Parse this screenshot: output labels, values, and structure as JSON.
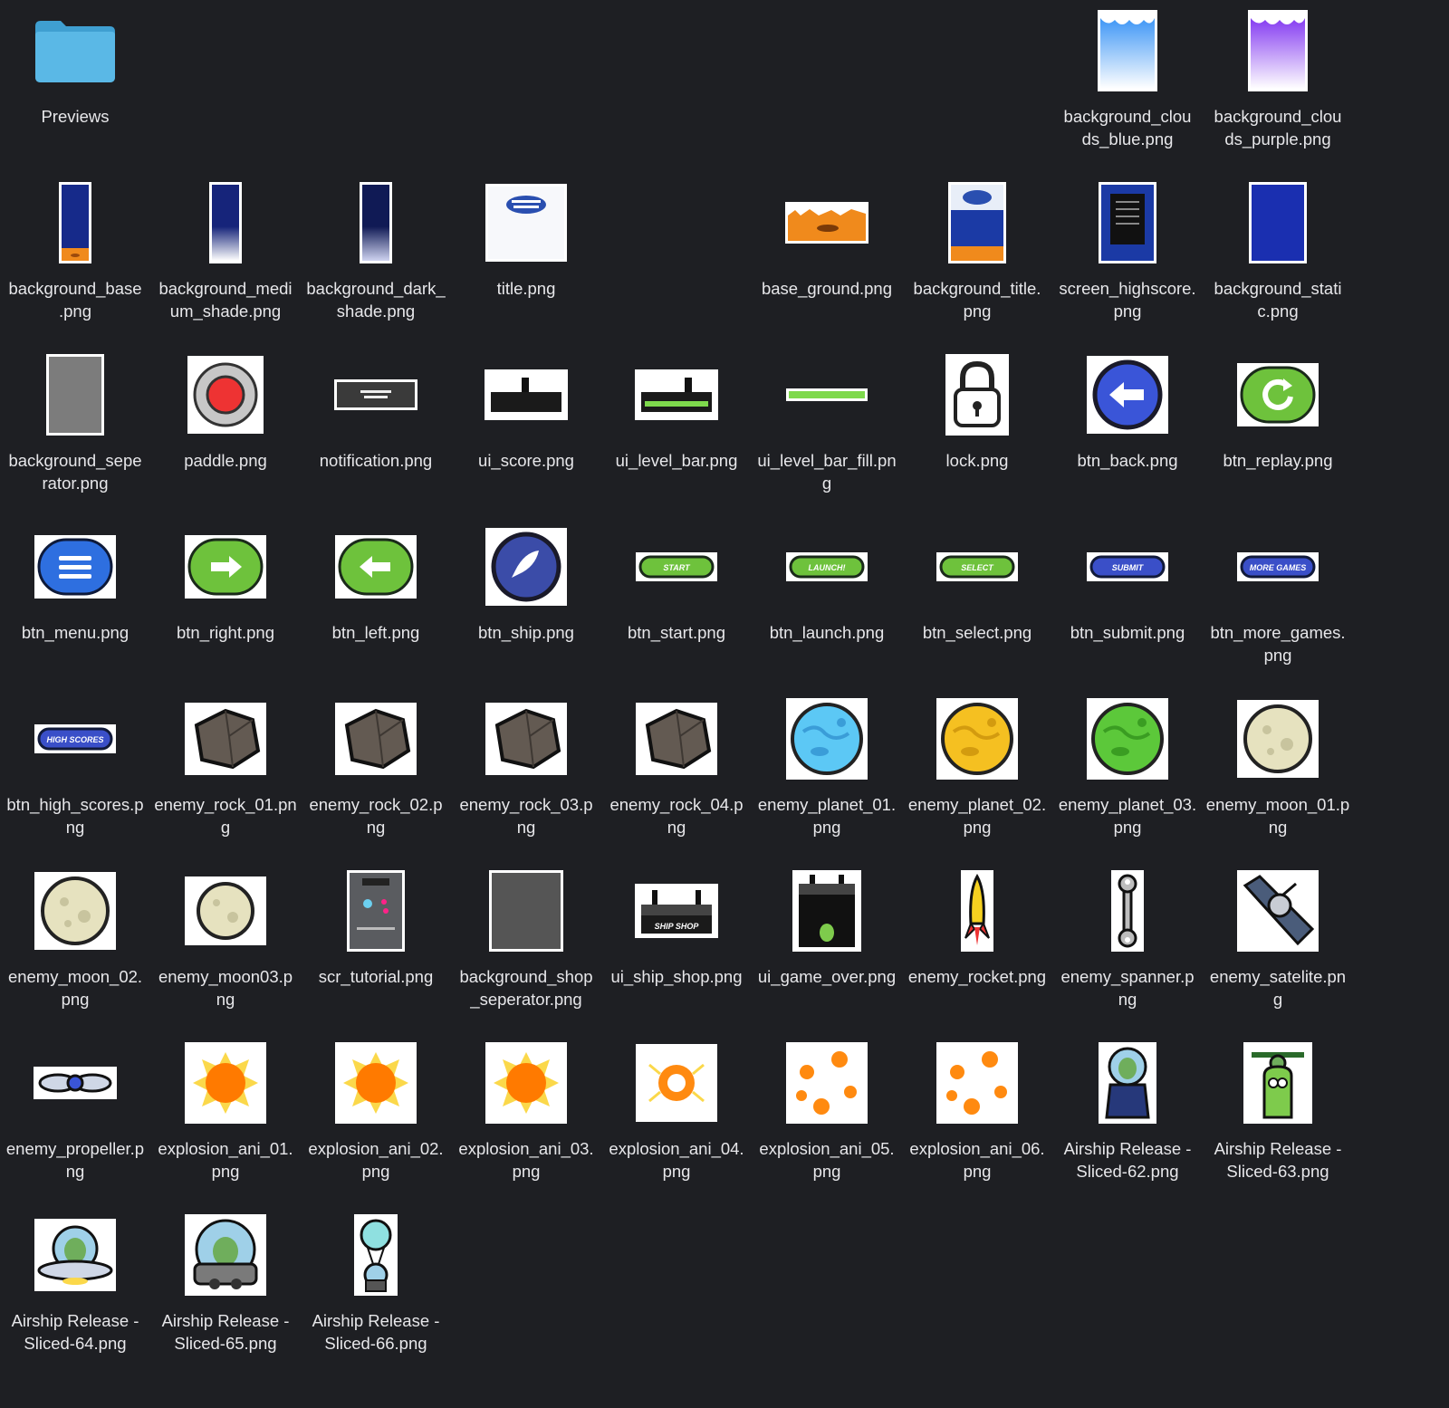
{
  "files": [
    {
      "name": "Previews",
      "icon": "folder-icon",
      "row": 0,
      "col": 0
    },
    {
      "name": "background_clou\nds_blue.png",
      "icon": "clouds-blue-image-icon",
      "row": 0,
      "col": 7
    },
    {
      "name": "background_clou\nds_purple.png",
      "icon": "clouds-purple-image-icon",
      "row": 0,
      "col": 8
    },
    {
      "name": "background_base\n.png",
      "icon": "background-base-image-icon",
      "row": 1,
      "col": 0
    },
    {
      "name": "background_medi\num_shade.png",
      "icon": "background-medium-shade-image-icon",
      "row": 1,
      "col": 1
    },
    {
      "name": "background_dark_\nshade.png",
      "icon": "background-dark-shade-image-icon",
      "row": 1,
      "col": 2
    },
    {
      "name": "title.png",
      "icon": "title-image-icon",
      "row": 1,
      "col": 3
    },
    {
      "name": "base_ground.png",
      "icon": "ground-image-icon",
      "row": 1,
      "col": 5
    },
    {
      "name": "background_title.\npng",
      "icon": "background-title-image-icon",
      "row": 1,
      "col": 6
    },
    {
      "name": "screen_highscore.\npng",
      "icon": "highscore-screen-image-icon",
      "row": 1,
      "col": 7
    },
    {
      "name": "background_stati\nc.png",
      "icon": "background-static-image-icon",
      "row": 1,
      "col": 8
    },
    {
      "name": "background_sepe\nrator.png",
      "icon": "separator-image-icon",
      "row": 2,
      "col": 0
    },
    {
      "name": "paddle.png",
      "icon": "paddle-image-icon",
      "row": 2,
      "col": 1
    },
    {
      "name": "notification.png",
      "icon": "notification-image-icon",
      "row": 2,
      "col": 2
    },
    {
      "name": "ui_score.png",
      "icon": "score-ui-image-icon",
      "row": 2,
      "col": 3
    },
    {
      "name": "ui_level_bar.png",
      "icon": "level-bar-image-icon",
      "row": 2,
      "col": 4
    },
    {
      "name": "ui_level_bar_fill.pn\ng",
      "icon": "level-bar-fill-image-icon",
      "row": 2,
      "col": 5
    },
    {
      "name": "lock.png",
      "icon": "lock-image-icon",
      "row": 2,
      "col": 6
    },
    {
      "name": "btn_back.png",
      "icon": "back-button-image-icon",
      "row": 2,
      "col": 7
    },
    {
      "name": "btn_replay.png",
      "icon": "replay-button-image-icon",
      "row": 2,
      "col": 8
    },
    {
      "name": "btn_menu.png",
      "icon": "menu-button-image-icon",
      "row": 3,
      "col": 0
    },
    {
      "name": "btn_right.png",
      "icon": "right-button-image-icon",
      "row": 3,
      "col": 1
    },
    {
      "name": "btn_left.png",
      "icon": "left-button-image-icon",
      "row": 3,
      "col": 2
    },
    {
      "name": "btn_ship.png",
      "icon": "ship-button-image-icon",
      "row": 3,
      "col": 3
    },
    {
      "name": "btn_start.png",
      "icon": "start-button-image-icon",
      "row": 3,
      "col": 4,
      "text": "START"
    },
    {
      "name": "btn_launch.png",
      "icon": "launch-button-image-icon",
      "row": 3,
      "col": 5,
      "text": "LAUNCH!"
    },
    {
      "name": "btn_select.png",
      "icon": "select-button-image-icon",
      "row": 3,
      "col": 6,
      "text": "SELECT"
    },
    {
      "name": "btn_submit.png",
      "icon": "submit-button-image-icon",
      "row": 3,
      "col": 7,
      "text": "SUBMIT"
    },
    {
      "name": "btn_more_games.\npng",
      "icon": "more-games-button-image-icon",
      "row": 3,
      "col": 8,
      "text": "MORE GAMES"
    },
    {
      "name": "btn_high_scores.p\nng",
      "icon": "high-scores-button-image-icon",
      "row": 4,
      "col": 0,
      "text": "HIGH SCORES"
    },
    {
      "name": "enemy_rock_01.pn\ng",
      "icon": "rock-image-icon",
      "row": 4,
      "col": 1
    },
    {
      "name": "enemy_rock_02.p\nng",
      "icon": "rock-image-icon",
      "row": 4,
      "col": 2
    },
    {
      "name": "enemy_rock_03.p\nng",
      "icon": "rock-image-icon",
      "row": 4,
      "col": 3
    },
    {
      "name": "enemy_rock_04.p\nng",
      "icon": "rock-image-icon",
      "row": 4,
      "col": 4
    },
    {
      "name": "enemy_planet_01.\npng",
      "icon": "planet-blue-image-icon",
      "row": 4,
      "col": 5
    },
    {
      "name": "enemy_planet_02.\npng",
      "icon": "planet-yellow-image-icon",
      "row": 4,
      "col": 6
    },
    {
      "name": "enemy_planet_03.\npng",
      "icon": "planet-green-image-icon",
      "row": 4,
      "col": 7
    },
    {
      "name": "enemy_moon_01.p\nng",
      "icon": "moon-image-icon",
      "row": 4,
      "col": 8
    },
    {
      "name": "enemy_moon_02.\npng",
      "icon": "moon-image-icon",
      "row": 5,
      "col": 0
    },
    {
      "name": "enemy_moon03.p\nng",
      "icon": "moon-small-image-icon",
      "row": 5,
      "col": 1
    },
    {
      "name": "scr_tutorial.png",
      "icon": "tutorial-screen-image-icon",
      "row": 5,
      "col": 2
    },
    {
      "name": "background_shop\n_seperator.png",
      "icon": "shop-separator-image-icon",
      "row": 5,
      "col": 3
    },
    {
      "name": "ui_ship_shop.png",
      "icon": "ship-shop-image-icon",
      "row": 5,
      "col": 4,
      "text": "SHIP SHOP"
    },
    {
      "name": "ui_game_over.png",
      "icon": "game-over-image-icon",
      "row": 5,
      "col": 5
    },
    {
      "name": "enemy_rocket.png",
      "icon": "rocket-image-icon",
      "row": 5,
      "col": 6
    },
    {
      "name": "enemy_spanner.p\nng",
      "icon": "spanner-image-icon",
      "row": 5,
      "col": 7
    },
    {
      "name": "enemy_satelite.pn\ng",
      "icon": "satellite-image-icon",
      "row": 5,
      "col": 8
    },
    {
      "name": "enemy_propeller.p\nng",
      "icon": "propeller-image-icon",
      "row": 6,
      "col": 0
    },
    {
      "name": "explosion_ani_01.\npng",
      "icon": "explosion-image-icon",
      "row": 6,
      "col": 1
    },
    {
      "name": "explosion_ani_02.\npng",
      "icon": "explosion-image-icon",
      "row": 6,
      "col": 2
    },
    {
      "name": "explosion_ani_03.\npng",
      "icon": "explosion-image-icon",
      "row": 6,
      "col": 3
    },
    {
      "name": "explosion_ani_04.\npng",
      "icon": "explosion-ring-image-icon",
      "row": 6,
      "col": 4
    },
    {
      "name": "explosion_ani_05.\npng",
      "icon": "explosion-scatter-image-icon",
      "row": 6,
      "col": 5
    },
    {
      "name": "explosion_ani_06.\npng",
      "icon": "explosion-scatter-image-icon",
      "row": 6,
      "col": 6
    },
    {
      "name": "Airship Release -\nSliced-62.png",
      "icon": "alien-pilot-image-icon",
      "row": 6,
      "col": 7
    },
    {
      "name": "Airship Release -\nSliced-63.png",
      "icon": "alien-heli-image-icon",
      "row": 6,
      "col": 8
    },
    {
      "name": "Airship Release -\nSliced-64.png",
      "icon": "alien-ufo-image-icon",
      "row": 7,
      "col": 0
    },
    {
      "name": "Airship Release -\nSliced-65.png",
      "icon": "alien-pod-image-icon",
      "row": 7,
      "col": 1
    },
    {
      "name": "Airship Release -\nSliced-66.png",
      "icon": "alien-balloon-image-icon",
      "row": 7,
      "col": 2
    }
  ]
}
